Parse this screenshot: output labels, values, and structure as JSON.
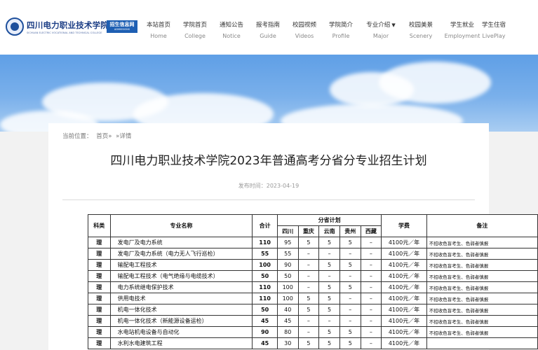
{
  "header": {
    "logo_cn": "四川电力职业技术学院",
    "logo_en": "SICHUAN ELECTRIC VOCATIONAL AND TECHNICAL COLLEGE",
    "badge_cn": "招生信息网",
    "badge_en": "ADMISSIONS",
    "nav": [
      {
        "cn": "本站首页",
        "en": "Home"
      },
      {
        "cn": "学院首页",
        "en": "College"
      },
      {
        "cn": "通知公告",
        "en": "Notice"
      },
      {
        "cn": "报考指南",
        "en": "Guide"
      },
      {
        "cn": "校园视频",
        "en": "Videos"
      },
      {
        "cn": "学院简介",
        "en": "Profile"
      },
      {
        "cn": "专业介绍",
        "en": "Major"
      },
      {
        "cn": "校园美景",
        "en": "Scenery"
      },
      {
        "cn": "学生就业",
        "en": "Employment"
      },
      {
        "cn": "学生住宿",
        "en": "LivePlay"
      }
    ]
  },
  "breadcrumb": {
    "label": "当前位置：",
    "home": "首页»",
    "current": "»详情"
  },
  "article": {
    "title": "四川电力职业技术学院2023年普通高考分省分专业招生计划",
    "date": "发布时间：2023-04-19"
  },
  "table": {
    "headers": {
      "category": "科类",
      "major": "专业名称",
      "total": "合计",
      "plan": "分省计划",
      "fee": "学费",
      "remark": "备注",
      "provinces": [
        "四川",
        "重庆",
        "云南",
        "贵州",
        "西藏"
      ]
    },
    "rows": [
      {
        "category": "理",
        "major": "发电厂及电力系统",
        "total": "110",
        "p": [
          "95",
          "5",
          "5",
          "5",
          "–"
        ],
        "fee": "4100元／年",
        "remark": "不招收色盲考生、色弱者慎报"
      },
      {
        "category": "理",
        "major": "发电厂及电力系统（电力无人飞行巡检）",
        "total": "55",
        "p": [
          "55",
          "–",
          "–",
          "–",
          "–"
        ],
        "fee": "4100元／年",
        "remark": "不招收色盲考生、色弱者慎报"
      },
      {
        "category": "理",
        "major": "输配电工程技术",
        "total": "100",
        "p": [
          "90",
          "–",
          "5",
          "5",
          "–"
        ],
        "fee": "4100元／年",
        "remark": "不招收色盲考生、色弱者慎报"
      },
      {
        "category": "理",
        "major": "输配电工程技术（电气绝缘与电缆技术）",
        "total": "50",
        "p": [
          "50",
          "–",
          "–",
          "–",
          "–"
        ],
        "fee": "4100元／年",
        "remark": "不招收色盲考生、色弱者慎报"
      },
      {
        "category": "理",
        "major": "电力系统继电保护技术",
        "total": "110",
        "p": [
          "100",
          "–",
          "5",
          "5",
          "–"
        ],
        "fee": "4100元／年",
        "remark": "不招收色盲考生、色弱者慎报"
      },
      {
        "category": "理",
        "major": "供用电技术",
        "total": "110",
        "p": [
          "100",
          "5",
          "5",
          "–",
          "–"
        ],
        "fee": "4100元／年",
        "remark": "不招收色盲考生、色弱者慎报"
      },
      {
        "category": "理",
        "major": "机电一体化技术",
        "total": "50",
        "p": [
          "40",
          "5",
          "5",
          "–",
          "–"
        ],
        "fee": "4100元／年",
        "remark": "不招收色盲考生、色弱者慎报"
      },
      {
        "category": "理",
        "major": "机电一体化技术（新能源设备运检）",
        "total": "45",
        "p": [
          "45",
          "–",
          "–",
          "–",
          "–"
        ],
        "fee": "4100元／年",
        "remark": "不招收色盲考生、色弱者慎报"
      },
      {
        "category": "理",
        "major": "水电站机电设备与自动化",
        "total": "90",
        "p": [
          "80",
          "–",
          "5",
          "5",
          "–"
        ],
        "fee": "4100元／年",
        "remark": "不招收色盲考生、色弱者慎报"
      },
      {
        "category": "理",
        "major": "水利水电建筑工程",
        "total": "45",
        "p": [
          "30",
          "5",
          "5",
          "5",
          "–"
        ],
        "fee": "4100元／年",
        "remark": ""
      }
    ]
  }
}
